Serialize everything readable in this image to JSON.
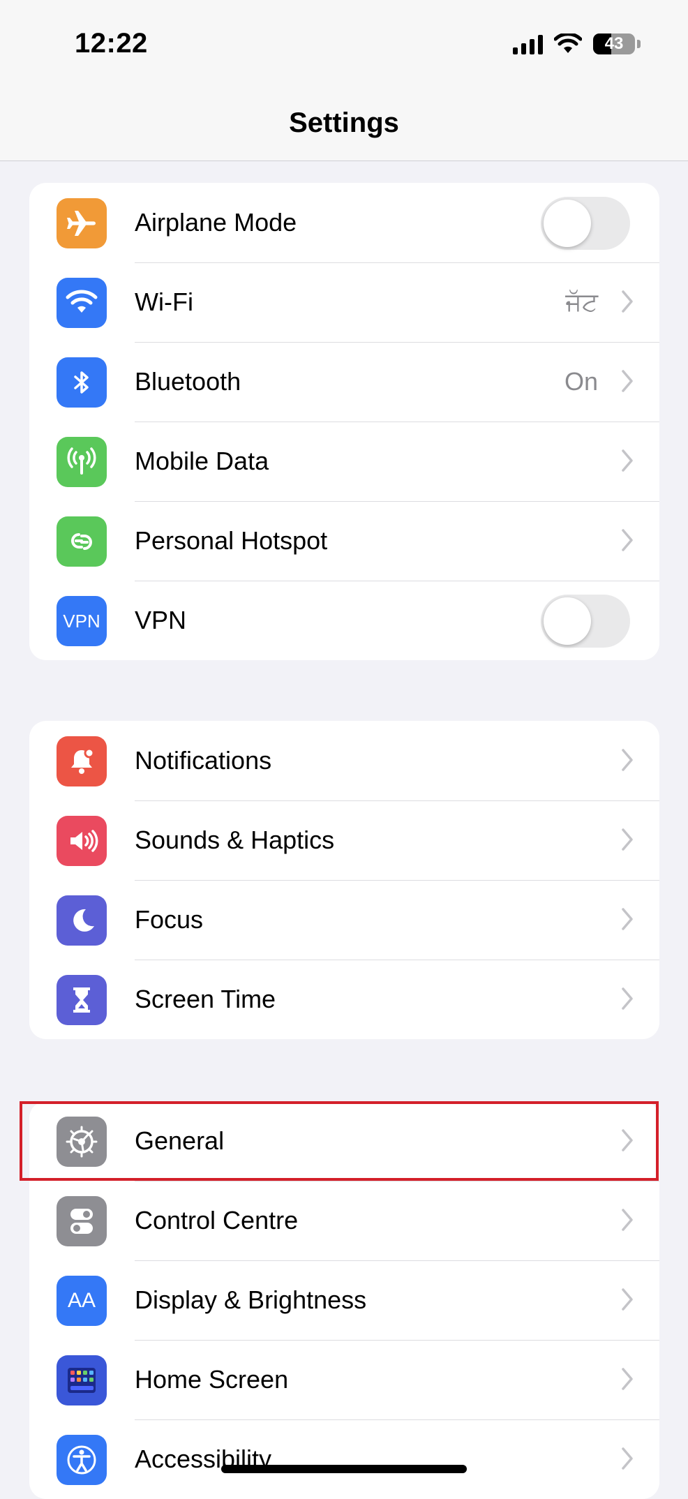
{
  "status": {
    "time": "12:22",
    "battery": "43",
    "battery_level": 0.43
  },
  "header": {
    "title": "Settings"
  },
  "groups": [
    {
      "items": [
        {
          "label": "Airplane Mode",
          "icon": "airplane-icon",
          "color": "#f19a37",
          "control": "toggle",
          "on": false
        },
        {
          "label": "Wi-Fi",
          "icon": "wifi-icon",
          "color": "#3478f6",
          "value": "ਜੱਟ",
          "control": "chevron"
        },
        {
          "label": "Bluetooth",
          "icon": "bluetooth-icon",
          "color": "#3478f6",
          "value": "On",
          "control": "chevron"
        },
        {
          "label": "Mobile Data",
          "icon": "antenna-icon",
          "color": "#5ac85a",
          "control": "chevron"
        },
        {
          "label": "Personal Hotspot",
          "icon": "hotspot-icon",
          "color": "#5ac85a",
          "control": "chevron"
        },
        {
          "label": "VPN",
          "icon": "vpn-icon",
          "icon_text": "VPN",
          "color": "#3478f6",
          "control": "toggle",
          "on": false
        }
      ]
    },
    {
      "items": [
        {
          "label": "Notifications",
          "icon": "notifications-bell-icon",
          "color": "#ec5545",
          "control": "chevron"
        },
        {
          "label": "Sounds & Haptics",
          "icon": "speaker-icon",
          "color": "#ea4a5f",
          "control": "chevron"
        },
        {
          "label": "Focus",
          "icon": "moon-icon",
          "color": "#5c5fd6",
          "control": "chevron"
        },
        {
          "label": "Screen Time",
          "icon": "hourglass-icon",
          "color": "#5c5fd6",
          "control": "chevron"
        }
      ]
    },
    {
      "items": [
        {
          "label": "General",
          "icon": "gear-icon",
          "color": "#8e8e93",
          "control": "chevron"
        },
        {
          "label": "Control Centre",
          "icon": "switches-icon",
          "color": "#8e8e93",
          "control": "chevron"
        },
        {
          "label": "Display & Brightness",
          "icon": "text-size-icon",
          "icon_text": "AA",
          "color": "#3478f6",
          "control": "chevron"
        },
        {
          "label": "Home Screen",
          "icon": "app-grid-icon",
          "color": "#3a57d8",
          "control": "chevron"
        },
        {
          "label": "Accessibility",
          "icon": "accessibility-icon",
          "color": "#3478f6",
          "control": "chevron"
        }
      ]
    }
  ]
}
